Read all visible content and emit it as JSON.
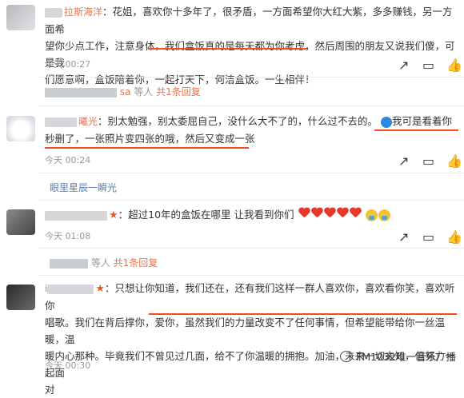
{
  "comments": [
    {
      "name": "拉斯海洋",
      "text": "：花姐，喜欢你十多年了，很矛盾，一方面希望你大红大紫，多多赚钱，另一方面希望你少点工作，注意身体，我们盒饭真的是每天都为你考虑，然后周围的朋友又说我们傻，可是我们愿意啊，盒饭陪着你，一起打天下，何洁盒饭。一生相伴！",
      "time": "今天 00:27",
      "likes_label": ""
    },
    {
      "name": "sa",
      "reply": "等人 共1条回复"
    },
    {
      "name": "曦光",
      "text": "：别太勉强，别太委屈自己，没什么大不了的，什么过不去的。 我可是看着你秒删了，一张照片变四张的哦，然后又变成一张",
      "time": "今天 00:24"
    },
    {
      "name": "眼里星辰一瞬光",
      "reply": "等人 共1条回复"
    },
    {
      "name": "",
      "text": "：超过10年的盒饭在哪里 让我看到你们",
      "time": "今天 01:08"
    },
    {
      "name": "",
      "reply": "等人 共1条回复"
    },
    {
      "name": "i",
      "text": "：只想让你知道，我们还在，还有我们这样一群人喜欢你，喜欢看你笑，喜欢听你唱歌。我们在背后撑你，爱你，虽然我们的力量改变不了任何事情，但希望能带给你一丝温暖，温暖内心那种。毕竟我们不曾见过几面，给不了你温暖的拥抱。加油，未来一切未知，但努力一起面对",
      "time": "今天 00:30"
    }
  ],
  "texts": {
    "c1_line1": "：花姐，喜欢你十多年了，很矛盾，一方面希望你大红大紫，多多赚钱，另一方面希",
    "c1_line2": "望你少点工作，注意身体，我们盒饭真的是每天都为你考虑，然后周围的朋友又说我们傻，可是我",
    "c1_line3": "们愿意啊，盒饭陪着你，一起打天下，何洁盒饭。一生相伴！",
    "c1_name": "拉斯海洋",
    "c1_time": "今天 00:27",
    "r1_name": "sa",
    "r1_text": "等人",
    "r1_link": "共1条回复",
    "c2_name": "曦光",
    "c2_line1": "：别太勉强，别太委屈自己，没什么大不了的，什么过不去的。",
    "c2_line1b": "我可是看着你",
    "c2_line2": "秒删了，一张照片变四张的哦，然后又变成一张",
    "c2_time": "今天 00:24",
    "r2_name": "眼里星辰一瞬光",
    "c3_line1": "：超过10年的盒饭在哪里 让我看到你们",
    "c3_time": "今天 01:08",
    "r3_text": "等人",
    "r3_link": "共1条回复",
    "c4_name": "i",
    "c4_line1": "：只想让你知道，我们还在，还有我们这样一群人喜欢你，喜欢看你笑，喜欢听你",
    "c4_line2": "唱歌。我们在背后撑你，爱你，虽然我们的力量改变不了任何事情，但希望能带给你一丝温暖，温",
    "c4_line3": "暖内心那种。毕竟我们不曾见过几面，给不了你温暖的拥抱。加油，未来一切未知，但努力一起面",
    "c4_line4": "对",
    "c4_time": "今天 00:30",
    "watermark": "FM1032唯一音乐广播"
  },
  "colors": {
    "name": "#eb7350",
    "underline": "#f24d1d",
    "muted": "#999999"
  }
}
